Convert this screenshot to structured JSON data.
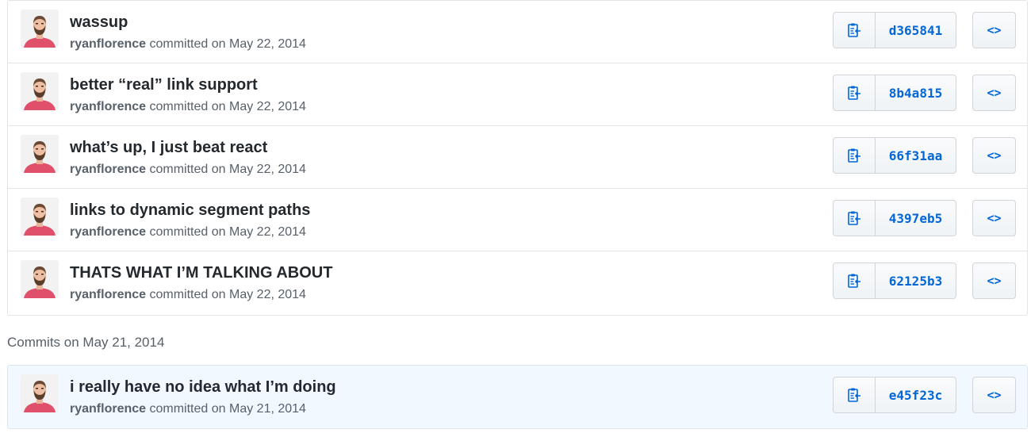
{
  "groups": [
    {
      "header": "",
      "commits": [
        {
          "title": "wassup",
          "author": "ryanflorence",
          "verb": "committed on",
          "date": "May 22, 2014",
          "sha": "d365841"
        },
        {
          "title": "better “real” link support",
          "author": "ryanflorence",
          "verb": "committed on",
          "date": "May 22, 2014",
          "sha": "8b4a815"
        },
        {
          "title": "what’s up, I just beat react",
          "author": "ryanflorence",
          "verb": "committed on",
          "date": "May 22, 2014",
          "sha": "66f31aa"
        },
        {
          "title": "links to dynamic segment paths",
          "author": "ryanflorence",
          "verb": "committed on",
          "date": "May 22, 2014",
          "sha": "4397eb5"
        },
        {
          "title": "THATS WHAT I’M TALKING ABOUT",
          "author": "ryanflorence",
          "verb": "committed on",
          "date": "May 22, 2014",
          "sha": "62125b3"
        }
      ]
    },
    {
      "header": "Commits on May 21, 2014",
      "commits": [
        {
          "title": "i really have no idea what I’m doing",
          "author": "ryanflorence",
          "verb": "committed on",
          "date": "May 21, 2014",
          "sha": "e45f23c"
        }
      ]
    }
  ],
  "icons": {
    "copy": "clippy-icon",
    "browse": "code-icon"
  },
  "browse_glyph": "<>",
  "colors": {
    "link": "#0366d6",
    "highlight_row": "#f1f8ff",
    "border": "#e1e4e8"
  }
}
